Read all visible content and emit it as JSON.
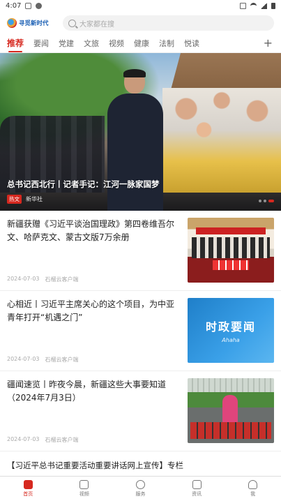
{
  "status_bar": {
    "time": "4:07",
    "icons": [
      "notification-icon",
      "app-icon",
      "vibrate-icon",
      "wifi-icon",
      "signal-icon",
      "battery-icon"
    ]
  },
  "header": {
    "logo_text": "寻觅新时代",
    "search_placeholder": "大家都在搜"
  },
  "tabs": [
    {
      "label": "推荐",
      "active": true
    },
    {
      "label": "要闻",
      "active": false
    },
    {
      "label": "党建",
      "active": false
    },
    {
      "label": "文旅",
      "active": false
    },
    {
      "label": "视频",
      "active": false
    },
    {
      "label": "健康",
      "active": false
    },
    {
      "label": "法制",
      "active": false
    },
    {
      "label": "悦读",
      "active": false
    }
  ],
  "hero": {
    "caption": "总书记西北行丨记者手记：江河一脉家国梦",
    "badge": "热文",
    "source": "新华社"
  },
  "news": [
    {
      "title": "新疆获赠《习近平谈治国理政》第四卷维吾尔文、哈萨克文、蒙古文版7万余册",
      "date": "2024-07-03",
      "source": "石榴云客户端"
    },
    {
      "title": "心相近丨习近平主席关心的这个项目，为中亚青年打开“机遇之门”",
      "date": "2024-07-03",
      "source": "石榴云客户端",
      "thumb_title": "时政要闻",
      "thumb_sub": "Ahaha"
    },
    {
      "title": "疆闻速览丨昨夜今晨，新疆这些大事要知道（2024年7月3日）",
      "date": "2024-07-03",
      "source": "石榴云客户端"
    }
  ],
  "promo": {
    "text": "【习近平总书记重要活动重要讲话网上宣传】专栏"
  },
  "bottom_nav": [
    {
      "label": "首页",
      "icon": "home-icon",
      "active": true
    },
    {
      "label": "视频",
      "icon": "video-icon",
      "active": false
    },
    {
      "label": "服务",
      "icon": "service-icon",
      "active": false
    },
    {
      "label": "资讯",
      "icon": "news-icon",
      "active": false
    },
    {
      "label": "我",
      "icon": "profile-icon",
      "active": false
    }
  ],
  "colors": {
    "accent": "#d6281f",
    "logo_blue": "#1a5fb4"
  }
}
